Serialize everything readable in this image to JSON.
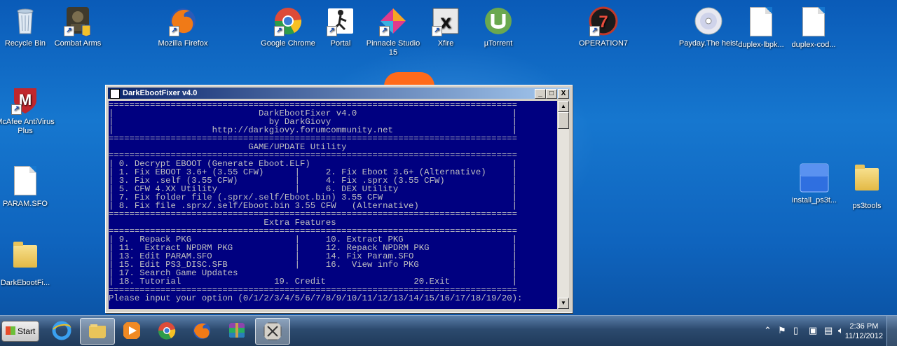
{
  "desktop": {
    "icons": [
      {
        "label": "Recycle Bin",
        "icon": "recycle-bin-icon"
      },
      {
        "label": "Combat Arms",
        "icon": "combat-arms-icon"
      },
      {
        "label": "Mozilla Firefox",
        "icon": "firefox-icon"
      },
      {
        "label": "Google Chrome",
        "icon": "chrome-icon"
      },
      {
        "label": "Portal",
        "icon": "portal-icon"
      },
      {
        "label": "Pinnacle Studio 15",
        "icon": "pinnacle-icon"
      },
      {
        "label": "Xfire",
        "icon": "xfire-icon"
      },
      {
        "label": "µTorrent",
        "icon": "utorrent-icon"
      },
      {
        "label": "OPERATION7",
        "icon": "operation7-icon"
      },
      {
        "label": "Payday.The heist",
        "icon": "disc-icon"
      },
      {
        "label": "duplex-lbpk...",
        "icon": "document-icon"
      },
      {
        "label": "duplex-cod...",
        "icon": "document-icon"
      },
      {
        "label": "McAfee AntiVirus Plus",
        "icon": "mcafee-icon"
      },
      {
        "label": "PARAM.SFO",
        "icon": "document-icon"
      },
      {
        "label": "DarkEbootFi...",
        "icon": "folder-icon"
      },
      {
        "label": "install_ps3t...",
        "icon": "install-icon"
      },
      {
        "label": "ps3tools",
        "icon": "folder-icon"
      }
    ]
  },
  "window": {
    "title": "DarkEbootFixer v4.0",
    "minimize": "_",
    "maximize": "□",
    "close": "X",
    "console_lines": [
      "===============================================================================",
      "|                            DarkEbootFixer v4.0                              |",
      "|                              by DarkGiovy                                   |",
      "|                   http://darkgiovy.forumcommunity.net                       |",
      "===============================================================================",
      "                           GAME/UPDATE Utility",
      "===============================================================================",
      "| 0. Decrypt EBOOT (Generate Eboot.ELF)                                       |",
      "| 1. Fix EBOOT 3.6+ (3.55 CFW)      |     2. Fix Eboot 3.6+ (Alternative)     |",
      "| 3. Fix .self (3.55 CFW)           |     4. Fix .sprx (3.55 CFW)             |",
      "| 5. CFW 4.XX Utility               |     6. DEX Utility                      |",
      "| 7. Fix folder file (.sprx/.self/Eboot.bin) 3.55 CFW                         |",
      "| 8. Fix file .sprx/.self/Eboot.bin 3.55 CFW   (Alternative)                  |",
      "===============================================================================",
      "                              Extra Features",
      "===============================================================================",
      "| 9.  Repack PKG                    |     10. Extract PKG                     |",
      "| 11.  Extract NPDRM PKG            |     12. Repack NPDRM PKG                |",
      "| 13. Edit PARAM.SFO                |     14. Fix Param.SFO                   |",
      "| 15. Edit PS3_DISC.SFB             |     16.  View info PKG                  |",
      "| 17. Search Game Updates                                                     |",
      "| 18. Tutorial                  19. Credit                 20.Exit            |",
      "===============================================================================",
      "Please input your option (0/1/2/3/4/5/6/7/8/9/10/11/12/13/14/15/16/17/18/19/20):"
    ]
  },
  "taskbar": {
    "start_label": "Start",
    "pinned": [
      {
        "name": "internet-explorer-icon"
      },
      {
        "name": "windows-explorer-icon"
      },
      {
        "name": "media-player-icon"
      },
      {
        "name": "chrome-icon"
      },
      {
        "name": "firefox-icon"
      },
      {
        "name": "winrar-icon"
      },
      {
        "name": "darkebootfixer-task-icon"
      }
    ],
    "tray": {
      "time": "2:36 PM",
      "date": "11/12/2012"
    }
  }
}
